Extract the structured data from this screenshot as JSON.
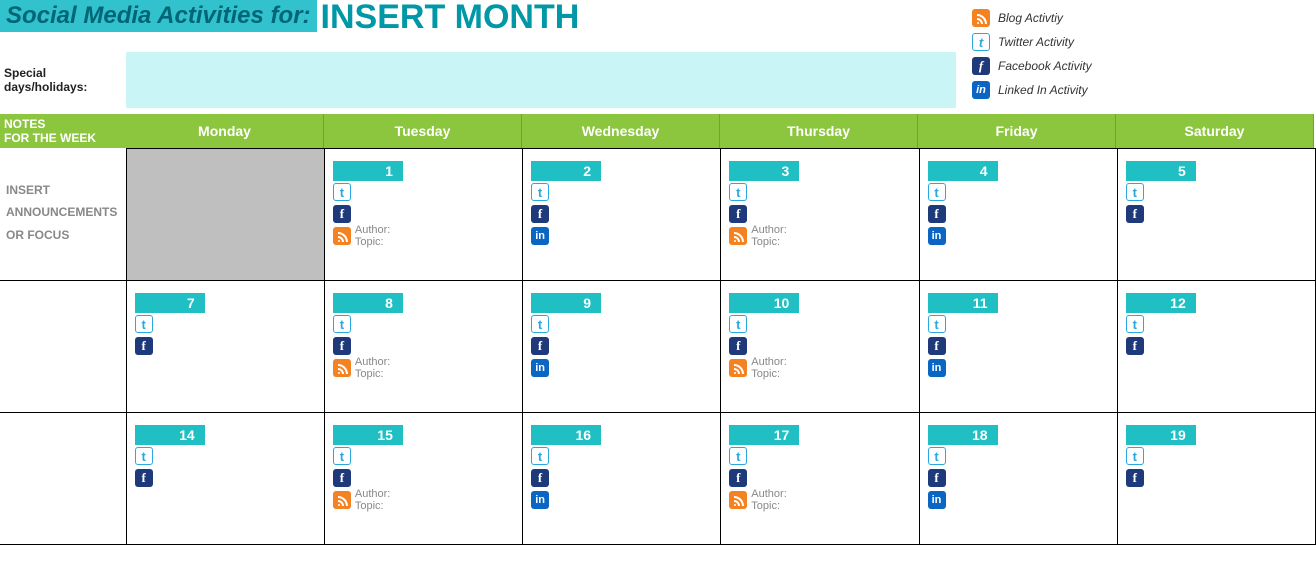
{
  "header": {
    "title_prefix": "Social Media Activities for:",
    "title_month": "INSERT MONTH",
    "special_label": "Special days/holidays:"
  },
  "legend": [
    {
      "icon": "rss",
      "label": "Blog Activtiy"
    },
    {
      "icon": "tw",
      "label": "Twitter Activity"
    },
    {
      "icon": "fb",
      "label": "Facebook Activity"
    },
    {
      "icon": "li",
      "label": "Linked In Activity"
    }
  ],
  "notes_header_line1": "NOTES",
  "notes_header_line2": "FOR THE WEEK",
  "days": [
    "Monday",
    "Tuesday",
    "Wednesday",
    "Thursday",
    "Friday",
    "Saturday"
  ],
  "notes_week1_l1": "INSERT",
  "notes_week1_l2": "ANNOUNCEMENTS",
  "notes_week1_l3": "OR FOCUS",
  "blog_author_label": "Author:",
  "blog_topic_label": "Topic:",
  "weeks": [
    [
      {
        "grey": true
      },
      {
        "date": "1",
        "tw": true,
        "fb": true,
        "rss": true
      },
      {
        "date": "2",
        "tw": true,
        "fb": true,
        "li": true
      },
      {
        "date": "3",
        "tw": true,
        "fb": true,
        "rss": true
      },
      {
        "date": "4",
        "tw": true,
        "fb": true,
        "li": true
      },
      {
        "date": "5",
        "tw": true,
        "fb": true
      }
    ],
    [
      {
        "date": "7",
        "tw": true,
        "fb": true
      },
      {
        "date": "8",
        "tw": true,
        "fb": true,
        "rss": true
      },
      {
        "date": "9",
        "tw": true,
        "fb": true,
        "li": true
      },
      {
        "date": "10",
        "tw": true,
        "fb": true,
        "rss": true
      },
      {
        "date": "11",
        "tw": true,
        "fb": true,
        "li": true
      },
      {
        "date": "12",
        "tw": true,
        "fb": true
      }
    ],
    [
      {
        "date": "14",
        "tw": true,
        "fb": true
      },
      {
        "date": "15",
        "tw": true,
        "fb": true,
        "rss": true
      },
      {
        "date": "16",
        "tw": true,
        "fb": true,
        "li": true
      },
      {
        "date": "17",
        "tw": true,
        "fb": true,
        "rss": true
      },
      {
        "date": "18",
        "tw": true,
        "fb": true,
        "li": true
      },
      {
        "date": "19",
        "tw": true,
        "fb": true
      }
    ]
  ]
}
